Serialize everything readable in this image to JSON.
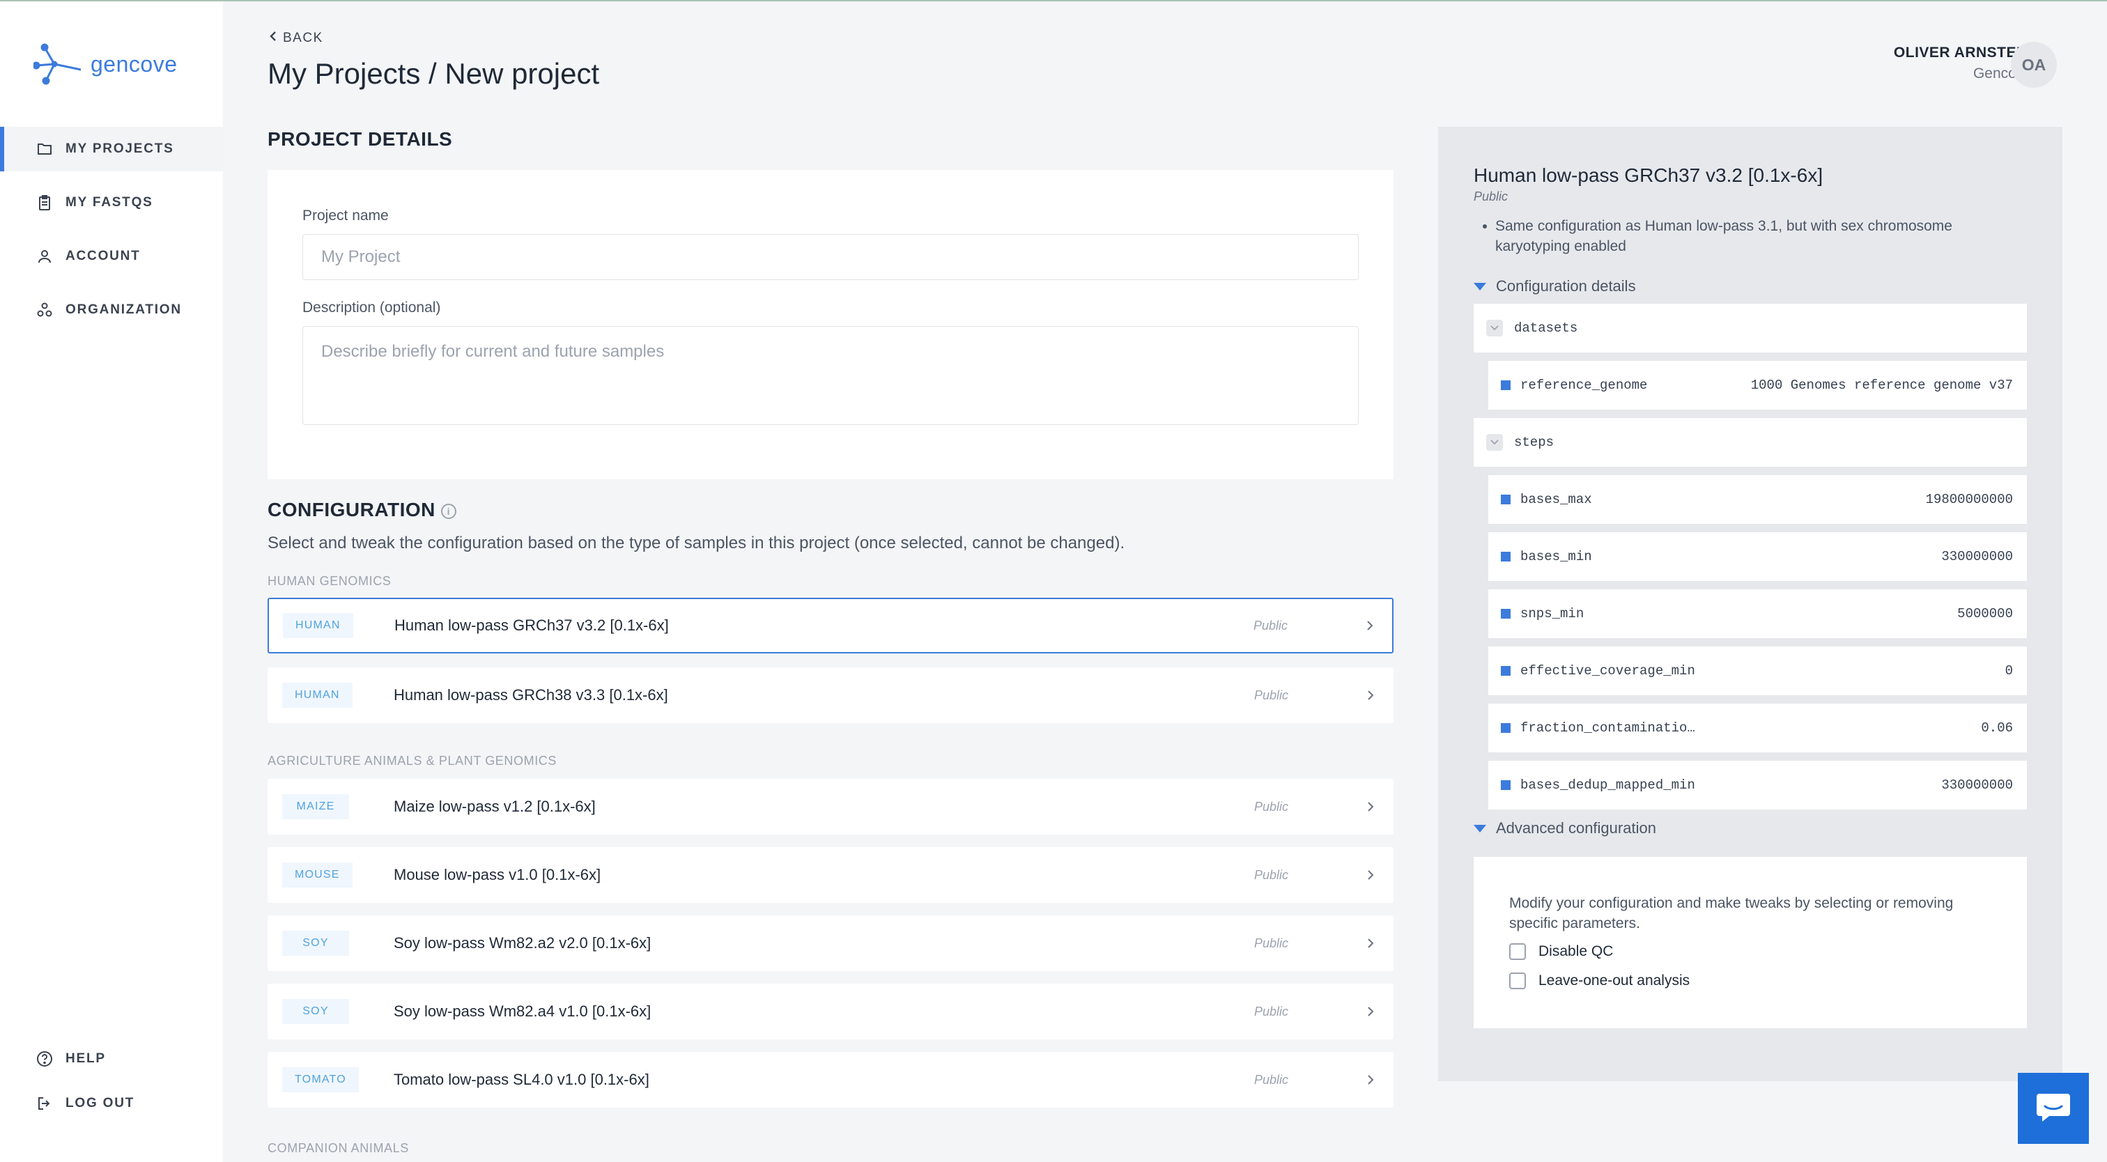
{
  "app": {
    "logo_text": "gencove"
  },
  "sidebar": {
    "items": [
      {
        "label": "MY PROJECTS",
        "icon": "folder-icon",
        "active": true
      },
      {
        "label": "MY FASTQS",
        "icon": "clipboard-icon",
        "active": false
      },
      {
        "label": "ACCOUNT",
        "icon": "user-icon",
        "active": false
      },
      {
        "label": "ORGANIZATION",
        "icon": "organization-icon",
        "active": false
      }
    ],
    "bottom": [
      {
        "label": "HELP",
        "icon": "help-icon"
      },
      {
        "label": "LOG OUT",
        "icon": "logout-icon"
      }
    ]
  },
  "header": {
    "back_label": "BACK",
    "title": "My Projects / New project",
    "user_name": "OLIVER ARNSTEIN",
    "user_org": "Gencove",
    "avatar_initials": "OA"
  },
  "project_details": {
    "title": "PROJECT DETAILS",
    "name_label": "Project name",
    "name_placeholder": "My Project",
    "name_value": "",
    "description_label": "Description (optional)",
    "description_placeholder": "Describe briefly for current and future samples",
    "description_value": ""
  },
  "configuration": {
    "title": "CONFIGURATION",
    "description": "Select and tweak the configuration based on the type of samples in this project (once selected, cannot be changed).",
    "groups": [
      {
        "label": "HUMAN GENOMICS",
        "items": [
          {
            "tag": "HUMAN",
            "name": "Human low-pass GRCh37 v3.2 [0.1x-6x]",
            "visibility": "Public",
            "selected": true
          },
          {
            "tag": "HUMAN",
            "name": "Human low-pass GRCh38 v3.3 [0.1x-6x]",
            "visibility": "Public",
            "selected": false
          }
        ]
      },
      {
        "label": "AGRICULTURE ANIMALS & PLANT GENOMICS",
        "items": [
          {
            "tag": "MAIZE",
            "name": "Maize low-pass v1.2 [0.1x-6x]",
            "visibility": "Public",
            "selected": false
          },
          {
            "tag": "MOUSE",
            "name": "Mouse low-pass v1.0 [0.1x-6x]",
            "visibility": "Public",
            "selected": false
          },
          {
            "tag": "SOY",
            "name": "Soy low-pass Wm82.a2 v2.0 [0.1x-6x]",
            "visibility": "Public",
            "selected": false
          },
          {
            "tag": "SOY",
            "name": "Soy low-pass Wm82.a4 v1.0 [0.1x-6x]",
            "visibility": "Public",
            "selected": false
          },
          {
            "tag": "TOMATO",
            "name": "Tomato low-pass SL4.0 v1.0 [0.1x-6x]",
            "visibility": "Public",
            "selected": false
          }
        ]
      },
      {
        "label": "COMPANION ANIMALS",
        "items": []
      }
    ]
  },
  "panel": {
    "title": "Human low-pass GRCh37 v3.2 [0.1x-6x]",
    "visibility": "Public",
    "bullet": "Same configuration as Human low-pass 3.1, but with sex chromosome karyotyping enabled",
    "config_details_label": "Configuration details",
    "datasets": {
      "key": "datasets",
      "items": [
        {
          "key": "reference_genome",
          "value": "1000 Genomes reference genome v37"
        }
      ]
    },
    "steps": {
      "key": "steps",
      "items": [
        {
          "key": "bases_max",
          "value": "19800000000"
        },
        {
          "key": "bases_min",
          "value": "330000000"
        },
        {
          "key": "snps_min",
          "value": "5000000"
        },
        {
          "key": "effective_coverage_min",
          "value": "0"
        },
        {
          "key": "fraction_contaminatio…",
          "value": "0.06"
        },
        {
          "key": "bases_dedup_mapped_min",
          "value": "330000000"
        }
      ]
    },
    "advanced_label": "Advanced configuration",
    "advanced_description": "Modify your configuration and make tweaks by selecting or removing specific parameters.",
    "options": [
      {
        "label": "Disable QC",
        "checked": false
      },
      {
        "label": "Leave-one-out analysis",
        "checked": false
      }
    ]
  },
  "colors": {
    "accent": "#3c7bdc",
    "tag_text": "#4fa3e0",
    "chat_button": "#1e6fd9",
    "panel_bg": "#e6e8ec"
  }
}
